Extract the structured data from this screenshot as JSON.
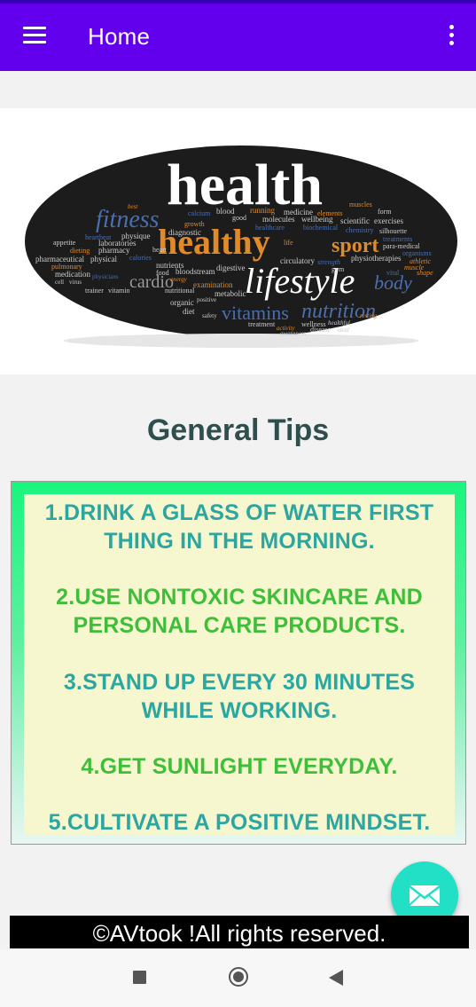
{
  "appbar": {
    "title": "Home",
    "menu_icon": "hamburger-menu-icon",
    "overflow_icon": "more-vert-icon"
  },
  "banner": {
    "words": {
      "health": "health",
      "fitness": "fitness",
      "healthy": "healthy",
      "sport": "sport",
      "lifestyle": "lifestyle",
      "body": "body",
      "vitamins": "vitamins",
      "nutrition": "nutrition",
      "cardio": "cardio",
      "physique": "physique",
      "laboratories": "laboratories",
      "pharmacy": "pharmacy",
      "pharmaceutical": "pharmaceutical",
      "physical": "physical",
      "medication": "medication",
      "circulatory": "circulatory",
      "physiotherapies": "physiotherapies",
      "medicine": "medicine",
      "molecules": "molecules",
      "wellbeing": "wellbeing",
      "scientific": "scientific",
      "exercises": "exercises",
      "diagnostic": "diagnostic",
      "blood": "blood",
      "running": "running",
      "nutrients": "nutrients",
      "bloodstream": "bloodstream",
      "digestive": "digestive",
      "examination": "examination",
      "metabolic": "metabolic",
      "organic": "organic",
      "diet": "diet",
      "treatment": "treatment",
      "wellness": "wellness",
      "disease": "disease",
      "appetite": "appetite",
      "heartbeat": "heartbeat",
      "dieting": "dieting",
      "pulmonary": "pulmonary",
      "trainer": "trainer",
      "vitamin": "vitamin",
      "muscles": "muscles",
      "form": "form",
      "elements": "elements",
      "biochemical": "biochemical",
      "chemistry": "chemistry",
      "silhouette": "silhouette",
      "treatments": "treatments",
      "para_medical": "para-medical",
      "organisms": "organisms",
      "athletic": "athletic",
      "muscle": "muscle",
      "shape": "shape",
      "vital": "vital",
      "strength": "strength",
      "gym": "gym",
      "calories": "calories",
      "heart": "heart",
      "growth": "growth",
      "calcium": "calcium",
      "good": "good",
      "healthcare": "healthcare",
      "life": "life",
      "food": "food",
      "nutritional": "nutritional",
      "safety": "safety",
      "activity": "activity",
      "awareness": "awareness",
      "ideal": "ideal",
      "healthful": "healthful",
      "resting": "resting",
      "positive": "positive",
      "virus": "virus",
      "physicians": "physicians",
      "best": "best",
      "energy": "energy",
      "cell": "cell"
    },
    "colors": {
      "white": "#ffffff",
      "blue": "#4a6fb0",
      "orange": "#e08a2a",
      "gray": "#9a9a9a"
    }
  },
  "main": {
    "heading": "General Tips",
    "tips": [
      {
        "line1": "1.DRINK A GLASS OF WATER FIRST",
        "line2": "THING IN THE MORNING."
      },
      {
        "line1": "2.USE NONTOXIC SKINCARE AND",
        "line2": "PERSONAL CARE PRODUCTS."
      },
      {
        "line1": "3.STAND UP EVERY 30 MINUTES",
        "line2": "WHILE WORKING."
      },
      {
        "line1": "4.GET SUNLIGHT EVERYDAY."
      },
      {
        "line1": "5.CULTIVATE A POSITIVE MINDSET."
      }
    ],
    "colors": {
      "teal": "#2ba6a0",
      "green": "#3fbe3a"
    }
  },
  "fab": {
    "icon": "mail-icon"
  },
  "footer": {
    "text": "©AVtook !All rights reserved."
  },
  "navbar": {
    "recents_icon": "square-recents-icon",
    "home_icon": "circle-home-icon",
    "back_icon": "triangle-back-icon"
  }
}
